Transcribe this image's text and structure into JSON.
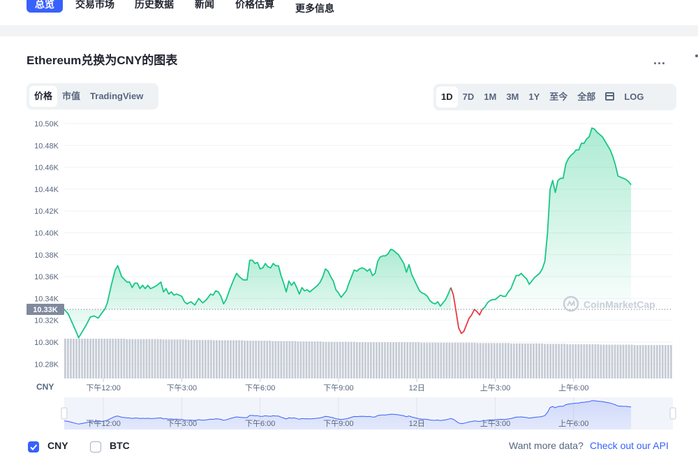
{
  "nav": {
    "items": [
      {
        "label": "总览"
      },
      {
        "label": "交易市场"
      },
      {
        "label": "历史数据"
      },
      {
        "label": "新闻"
      },
      {
        "label": "价格估算"
      },
      {
        "label": "更多信息"
      }
    ]
  },
  "card": {
    "title": "Ethereum兑换为CNY的图表",
    "more_label": "..."
  },
  "chart_tabs": [
    {
      "label": "价格"
    },
    {
      "label": "市值"
    },
    {
      "label": "TradingView"
    }
  ],
  "ranges": [
    {
      "label": "1D"
    },
    {
      "label": "7D"
    },
    {
      "label": "1M"
    },
    {
      "label": "3M"
    },
    {
      "label": "1Y"
    },
    {
      "label": "至今"
    },
    {
      "label": "全部"
    }
  ],
  "log_label": "LOG",
  "watermark": "CoinMarketCap",
  "current_price_label": "10.33K",
  "colors": {
    "up": "#16c784",
    "down": "#ea3943",
    "accent": "#3861fb",
    "volume": "#c6ccd6"
  },
  "chart_data": {
    "type": "line",
    "currency_label": "CNY",
    "y_ticks": [
      "10.50K",
      "10.48K",
      "10.46K",
      "10.44K",
      "10.42K",
      "10.40K",
      "10.38K",
      "10.36K",
      "10.34K",
      "10.32K",
      "10.30K",
      "10.28K"
    ],
    "ylim": [
      10270,
      10500
    ],
    "x_ticks": [
      {
        "label": "下午12:00",
        "t": 1.5
      },
      {
        "label": "下午3:00",
        "t": 4.5
      },
      {
        "label": "下午6:00",
        "t": 7.5
      },
      {
        "label": "下午9:00",
        "t": 10.5
      },
      {
        "label": "12日",
        "t": 13.5
      },
      {
        "label": "上午3:00",
        "t": 16.5
      },
      {
        "label": "上午6:00",
        "t": 19.5
      }
    ],
    "xlim": [
      0,
      23.3
    ],
    "baseline": 10330,
    "series": [
      {
        "values": [
          [
            0.0,
            10330
          ],
          [
            0.15,
            10326
          ],
          [
            0.3,
            10318
          ],
          [
            0.45,
            10310
          ],
          [
            0.55,
            10304
          ],
          [
            0.7,
            10310
          ],
          [
            0.85,
            10316
          ],
          [
            1.0,
            10323
          ],
          [
            1.15,
            10324
          ],
          [
            1.3,
            10322
          ],
          [
            1.45,
            10327
          ],
          [
            1.55,
            10330
          ],
          [
            1.65,
            10336
          ],
          [
            1.8,
            10352
          ],
          [
            1.95,
            10366
          ],
          [
            2.05,
            10370
          ],
          [
            2.2,
            10360
          ],
          [
            2.4,
            10355
          ],
          [
            2.5,
            10355
          ],
          [
            2.6,
            10350
          ],
          [
            2.7,
            10354
          ],
          [
            2.8,
            10354
          ],
          [
            2.9,
            10349
          ],
          [
            3.0,
            10352
          ],
          [
            3.1,
            10349
          ],
          [
            3.2,
            10352
          ],
          [
            3.3,
            10349
          ],
          [
            3.4,
            10350
          ],
          [
            3.55,
            10352
          ],
          [
            3.7,
            10355
          ],
          [
            3.8,
            10346
          ],
          [
            3.9,
            10349
          ],
          [
            4.0,
            10344
          ],
          [
            4.1,
            10346
          ],
          [
            4.2,
            10343
          ],
          [
            4.3,
            10344
          ],
          [
            4.4,
            10343
          ],
          [
            4.5,
            10342
          ],
          [
            4.6,
            10337
          ],
          [
            4.7,
            10335
          ],
          [
            4.85,
            10337
          ],
          [
            5.0,
            10334
          ],
          [
            5.15,
            10340
          ],
          [
            5.3,
            10336
          ],
          [
            5.45,
            10339
          ],
          [
            5.6,
            10344
          ],
          [
            5.7,
            10343
          ],
          [
            5.8,
            10347
          ],
          [
            5.9,
            10346
          ],
          [
            6.0,
            10342
          ],
          [
            6.1,
            10335
          ],
          [
            6.2,
            10339
          ],
          [
            6.35,
            10349
          ],
          [
            6.5,
            10358
          ],
          [
            6.6,
            10363
          ],
          [
            6.7,
            10360
          ],
          [
            6.85,
            10357
          ],
          [
            7.0,
            10357
          ],
          [
            7.1,
            10375
          ],
          [
            7.2,
            10375
          ],
          [
            7.3,
            10372
          ],
          [
            7.4,
            10373
          ],
          [
            7.5,
            10367
          ],
          [
            7.6,
            10368
          ],
          [
            7.7,
            10372
          ],
          [
            7.8,
            10369
          ],
          [
            7.9,
            10368
          ],
          [
            8.0,
            10372
          ],
          [
            8.1,
            10370
          ],
          [
            8.2,
            10370
          ],
          [
            8.3,
            10361
          ],
          [
            8.4,
            10354
          ],
          [
            8.5,
            10346
          ],
          [
            8.6,
            10356
          ],
          [
            8.7,
            10352
          ],
          [
            8.8,
            10355
          ],
          [
            8.9,
            10350
          ],
          [
            9.0,
            10344
          ],
          [
            9.1,
            10350
          ],
          [
            9.2,
            10347
          ],
          [
            9.3,
            10348
          ],
          [
            9.4,
            10346
          ],
          [
            9.5,
            10348
          ],
          [
            9.6,
            10350
          ],
          [
            9.7,
            10352
          ],
          [
            9.8,
            10355
          ],
          [
            9.9,
            10360
          ],
          [
            10.0,
            10367
          ],
          [
            10.1,
            10365
          ],
          [
            10.2,
            10360
          ],
          [
            10.3,
            10356
          ],
          [
            10.4,
            10348
          ],
          [
            10.5,
            10345
          ],
          [
            10.6,
            10341
          ],
          [
            10.7,
            10344
          ],
          [
            10.8,
            10347
          ],
          [
            10.9,
            10354
          ],
          [
            11.0,
            10360
          ],
          [
            11.1,
            10366
          ],
          [
            11.2,
            10365
          ],
          [
            11.3,
            10367
          ],
          [
            11.4,
            10368
          ],
          [
            11.5,
            10367
          ],
          [
            11.6,
            10365
          ],
          [
            11.7,
            10367
          ],
          [
            11.8,
            10361
          ],
          [
            11.9,
            10363
          ],
          [
            12.0,
            10374
          ],
          [
            12.1,
            10378
          ],
          [
            12.2,
            10379
          ],
          [
            12.3,
            10379
          ],
          [
            12.4,
            10381
          ],
          [
            12.5,
            10385
          ],
          [
            12.6,
            10384
          ],
          [
            12.7,
            10382
          ],
          [
            12.8,
            10380
          ],
          [
            12.9,
            10376
          ],
          [
            13.0,
            10372
          ],
          [
            13.1,
            10364
          ],
          [
            13.2,
            10371
          ],
          [
            13.3,
            10362
          ],
          [
            13.4,
            10357
          ],
          [
            13.5,
            10352
          ],
          [
            13.6,
            10347
          ],
          [
            13.7,
            10345
          ],
          [
            13.8,
            10344
          ],
          [
            13.9,
            10342
          ],
          [
            14.0,
            10338
          ],
          [
            14.1,
            10336
          ],
          [
            14.2,
            10335
          ],
          [
            14.3,
            10337
          ],
          [
            14.4,
            10333
          ],
          [
            14.5,
            10336
          ],
          [
            14.6,
            10339
          ],
          [
            14.7,
            10344
          ],
          [
            14.8,
            10350
          ]
        ],
        "color": "up"
      },
      {
        "values": [
          [
            14.8,
            10350
          ],
          [
            14.9,
            10343
          ],
          [
            15.0,
            10328
          ],
          [
            15.1,
            10313
          ],
          [
            15.2,
            10308
          ],
          [
            15.3,
            10310
          ],
          [
            15.4,
            10316
          ],
          [
            15.5,
            10322
          ],
          [
            15.6,
            10325
          ],
          [
            15.7,
            10330
          ],
          [
            15.8,
            10328
          ],
          [
            15.9,
            10325
          ],
          [
            16.0,
            10330
          ]
        ],
        "color": "down"
      },
      {
        "values": [
          [
            16.0,
            10330
          ],
          [
            16.1,
            10332
          ],
          [
            16.2,
            10336
          ],
          [
            16.3,
            10338
          ],
          [
            16.4,
            10339
          ],
          [
            16.5,
            10339
          ],
          [
            16.6,
            10341
          ],
          [
            16.7,
            10343
          ],
          [
            16.8,
            10342
          ],
          [
            16.9,
            10342
          ],
          [
            17.0,
            10346
          ],
          [
            17.1,
            10349
          ],
          [
            17.2,
            10355
          ],
          [
            17.3,
            10361
          ],
          [
            17.4,
            10361
          ],
          [
            17.5,
            10363
          ],
          [
            17.6,
            10360
          ],
          [
            17.7,
            10358
          ],
          [
            17.8,
            10353
          ],
          [
            17.9,
            10356
          ],
          [
            18.0,
            10359
          ],
          [
            18.1,
            10361
          ],
          [
            18.2,
            10363
          ],
          [
            18.3,
            10367
          ],
          [
            18.4,
            10374
          ],
          [
            18.5,
            10400
          ],
          [
            18.6,
            10440
          ],
          [
            18.7,
            10448
          ],
          [
            18.8,
            10437
          ],
          [
            18.9,
            10448
          ],
          [
            19.0,
            10450
          ],
          [
            19.1,
            10450
          ],
          [
            19.2,
            10463
          ],
          [
            19.3,
            10468
          ],
          [
            19.4,
            10471
          ],
          [
            19.5,
            10473
          ],
          [
            19.6,
            10476
          ],
          [
            19.7,
            10476
          ],
          [
            19.8,
            10482
          ],
          [
            19.9,
            10482
          ],
          [
            20.0,
            10486
          ],
          [
            20.1,
            10488
          ],
          [
            20.2,
            10496
          ],
          [
            20.3,
            10495
          ],
          [
            20.4,
            10492
          ],
          [
            20.5,
            10490
          ],
          [
            20.6,
            10488
          ],
          [
            20.7,
            10484
          ],
          [
            20.8,
            10480
          ],
          [
            20.9,
            10476
          ],
          [
            21.0,
            10470
          ],
          [
            21.1,
            10462
          ],
          [
            21.2,
            10452
          ],
          [
            21.3,
            10451
          ],
          [
            21.4,
            10450
          ],
          [
            21.5,
            10449
          ],
          [
            21.6,
            10447
          ],
          [
            21.7,
            10444
          ]
        ],
        "color": "up"
      }
    ],
    "volume": [
      1.0,
      1.0,
      1.0,
      1.0,
      1.0,
      1.0,
      1.0,
      1.0,
      1.0,
      1.0,
      1.0,
      1.0,
      1.0,
      1.0,
      1.0,
      1.0,
      1.0,
      1.0,
      1.0,
      1.0,
      1.0,
      1.0,
      0.99,
      0.99,
      0.99,
      0.99,
      0.99,
      0.99,
      0.99,
      0.99,
      0.99,
      0.99,
      0.99,
      0.99,
      0.99,
      0.98,
      0.98,
      0.98,
      0.98,
      0.98,
      0.98,
      0.98,
      0.98,
      0.98,
      0.97,
      0.97,
      0.97,
      0.97,
      0.97,
      0.97,
      0.97,
      0.97,
      0.97,
      0.96,
      0.96,
      0.96,
      0.96,
      0.96,
      0.96,
      0.96,
      0.96,
      0.96,
      0.96,
      0.96,
      0.95,
      0.95,
      0.95,
      0.95,
      0.95,
      0.95,
      0.95,
      0.95,
      0.95,
      0.95,
      0.94,
      0.94,
      0.94,
      0.94,
      0.94,
      0.94,
      0.94,
      0.94,
      0.94,
      0.93,
      0.93,
      0.93,
      0.93,
      0.93,
      0.93,
      0.93,
      0.93,
      0.93,
      0.92,
      0.92,
      0.92,
      0.92,
      0.92,
      0.92,
      0.92,
      0.92,
      0.92,
      0.92,
      0.92,
      0.92,
      0.91,
      0.91,
      0.91,
      0.91,
      0.91,
      0.91,
      0.91,
      0.91,
      0.91,
      0.91,
      0.91,
      0.91,
      0.91,
      0.91,
      0.91,
      0.91,
      0.91,
      0.91,
      0.91,
      0.91,
      0.91,
      0.91,
      0.91,
      0.9,
      0.9,
      0.9,
      0.9,
      0.9,
      0.9,
      0.9,
      0.9,
      0.9,
      0.9,
      0.9,
      0.9,
      0.9,
      0.9,
      0.9,
      0.9,
      0.9,
      0.9,
      0.9,
      0.9,
      0.89,
      0.89,
      0.89,
      0.89,
      0.89,
      0.89,
      0.89,
      0.89,
      0.89,
      0.89,
      0.89,
      0.89,
      0.88,
      0.88,
      0.88,
      0.88,
      0.88,
      0.88,
      0.88,
      0.88,
      0.88,
      0.88,
      0.88,
      0.88,
      0.87,
      0.87,
      0.87,
      0.87,
      0.87,
      0.87,
      0.87,
      0.87,
      0.86,
      0.86,
      0.86,
      0.86,
      0.86,
      0.86,
      0.86,
      0.86,
      0.86,
      0.86,
      0.86,
      0.86,
      0.85,
      0.85,
      0.85,
      0.85,
      0.85,
      0.85,
      0.85,
      0.85,
      0.85,
      0.85,
      0.85,
      0.85,
      0.84,
      0.84,
      0.84,
      0.84,
      0.84,
      0.84,
      0.84,
      0.84,
      0.84,
      0.84,
      0.84,
      0.84,
      0.84,
      0.84
    ]
  },
  "footer": {
    "cny_label": "CNY",
    "btc_label": "BTC",
    "want_more": "Want more data?",
    "api_link": "Check out our API"
  }
}
